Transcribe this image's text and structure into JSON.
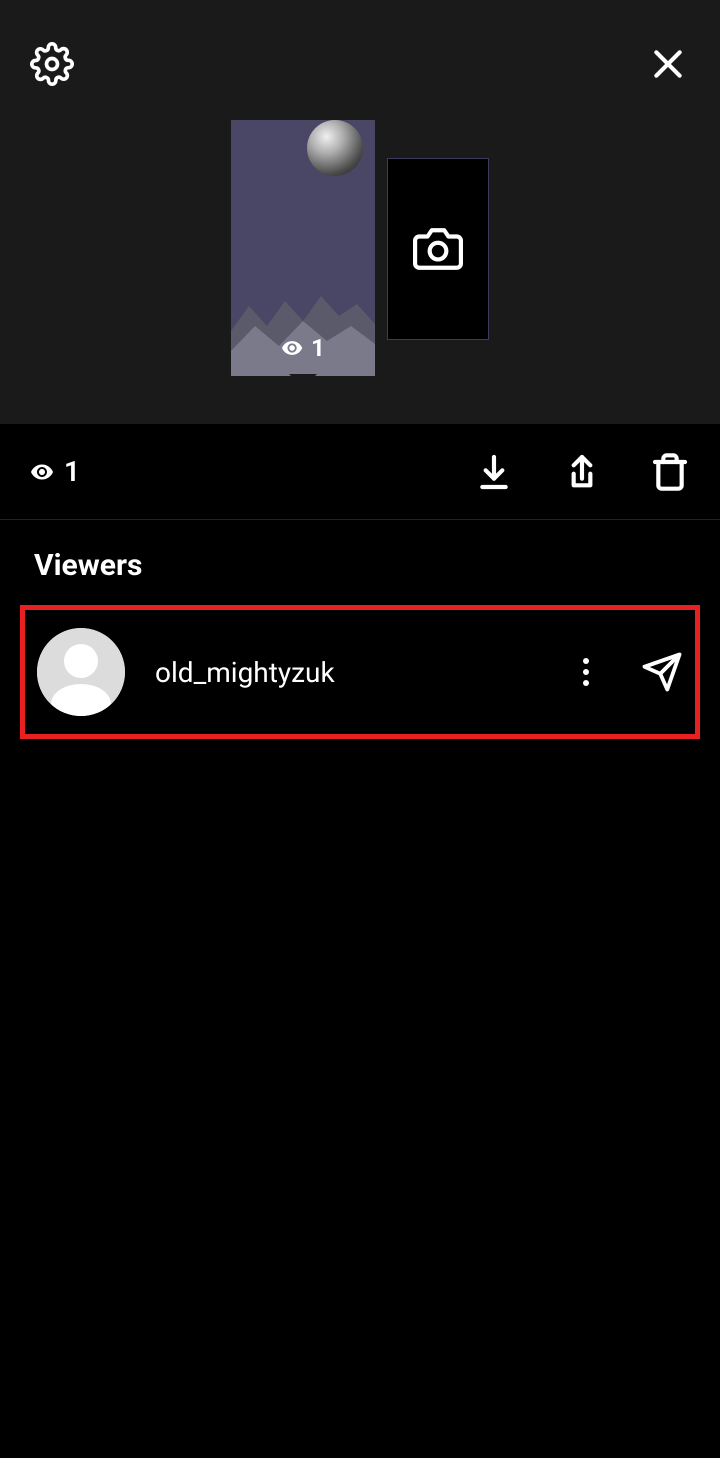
{
  "story": {
    "view_count": "1",
    "thumbnail_view_count": "1"
  },
  "action_bar": {
    "view_count": "1"
  },
  "viewers": {
    "title": "Viewers",
    "list": [
      {
        "username": "old_mightyzuk"
      }
    ]
  },
  "icons": {
    "settings": "settings",
    "close": "close",
    "camera": "camera",
    "download": "download",
    "share": "share",
    "delete": "delete",
    "eye": "eye",
    "more": "more",
    "send": "send"
  }
}
